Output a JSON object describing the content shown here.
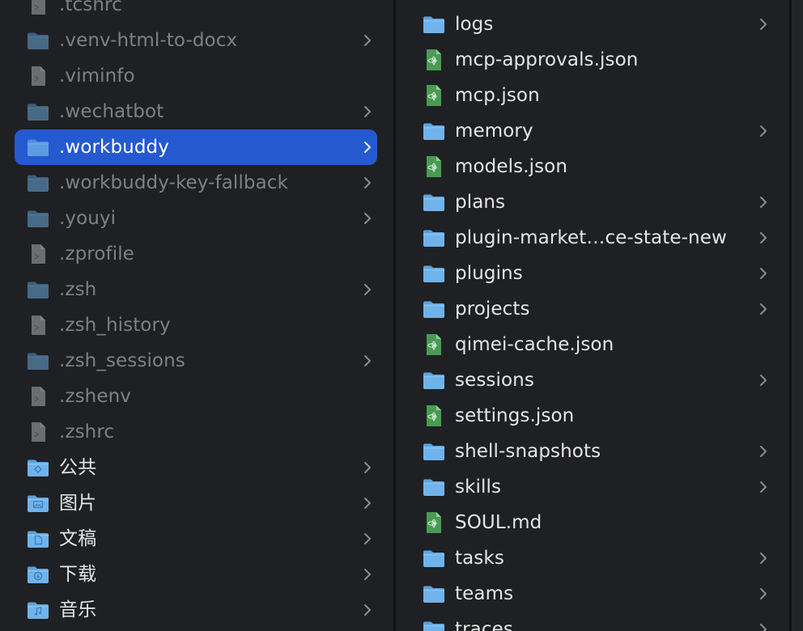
{
  "colors": {
    "background": "#1f2023",
    "selection": "#2559d0",
    "folder_blue": "#6fb3ea",
    "file_green": "#4b9a54",
    "text": "#e6e6e6",
    "text_dim": "#808084"
  },
  "columns": [
    {
      "id": "left",
      "items": [
        {
          "name": ".tcshrc",
          "kind": "file",
          "dim": true,
          "selected": false,
          "has_children": false
        },
        {
          "name": ".venv-html-to-docx",
          "kind": "folder",
          "dim": true,
          "selected": false,
          "has_children": true
        },
        {
          "name": ".viminfo",
          "kind": "file",
          "dim": true,
          "selected": false,
          "has_children": false
        },
        {
          "name": ".wechatbot",
          "kind": "folder",
          "dim": true,
          "selected": false,
          "has_children": true
        },
        {
          "name": ".workbuddy",
          "kind": "folder",
          "dim": false,
          "selected": true,
          "has_children": true
        },
        {
          "name": ".workbuddy-key-fallback",
          "kind": "folder",
          "dim": true,
          "selected": false,
          "has_children": true
        },
        {
          "name": ".youyi",
          "kind": "folder",
          "dim": true,
          "selected": false,
          "has_children": true
        },
        {
          "name": ".zprofile",
          "kind": "file",
          "dim": true,
          "selected": false,
          "has_children": false
        },
        {
          "name": ".zsh",
          "kind": "folder",
          "dim": true,
          "selected": false,
          "has_children": true
        },
        {
          "name": ".zsh_history",
          "kind": "file",
          "dim": true,
          "selected": false,
          "has_children": false
        },
        {
          "name": ".zsh_sessions",
          "kind": "folder",
          "dim": true,
          "selected": false,
          "has_children": true
        },
        {
          "name": ".zshenv",
          "kind": "file",
          "dim": true,
          "selected": false,
          "has_children": false
        },
        {
          "name": ".zshrc",
          "kind": "file",
          "dim": true,
          "selected": false,
          "has_children": false
        },
        {
          "name": "公共",
          "kind": "public-folder",
          "dim": false,
          "selected": false,
          "has_children": true
        },
        {
          "name": "图片",
          "kind": "pictures-folder",
          "dim": false,
          "selected": false,
          "has_children": true
        },
        {
          "name": "文稿",
          "kind": "documents-folder",
          "dim": false,
          "selected": false,
          "has_children": true
        },
        {
          "name": "下载",
          "kind": "downloads-folder",
          "dim": false,
          "selected": false,
          "has_children": true
        },
        {
          "name": "音乐",
          "kind": "music-folder",
          "dim": false,
          "selected": false,
          "has_children": true
        }
      ]
    },
    {
      "id": "right",
      "items": [
        {
          "name": "logs",
          "kind": "folder",
          "dim": false,
          "selected": false,
          "has_children": true
        },
        {
          "name": "mcp-approvals.json",
          "kind": "json",
          "dim": false,
          "selected": false,
          "has_children": false
        },
        {
          "name": "mcp.json",
          "kind": "json",
          "dim": false,
          "selected": false,
          "has_children": false
        },
        {
          "name": "memory",
          "kind": "folder",
          "dim": false,
          "selected": false,
          "has_children": true
        },
        {
          "name": "models.json",
          "kind": "json",
          "dim": false,
          "selected": false,
          "has_children": false
        },
        {
          "name": "plans",
          "kind": "folder",
          "dim": false,
          "selected": false,
          "has_children": true
        },
        {
          "name": "plugin-market…ce-state-new",
          "kind": "folder",
          "dim": false,
          "selected": false,
          "has_children": true
        },
        {
          "name": "plugins",
          "kind": "folder",
          "dim": false,
          "selected": false,
          "has_children": true
        },
        {
          "name": "projects",
          "kind": "folder",
          "dim": false,
          "selected": false,
          "has_children": true
        },
        {
          "name": "qimei-cache.json",
          "kind": "json",
          "dim": false,
          "selected": false,
          "has_children": false
        },
        {
          "name": "sessions",
          "kind": "folder",
          "dim": false,
          "selected": false,
          "has_children": true
        },
        {
          "name": "settings.json",
          "kind": "json",
          "dim": false,
          "selected": false,
          "has_children": false
        },
        {
          "name": "shell-snapshots",
          "kind": "folder",
          "dim": false,
          "selected": false,
          "has_children": true
        },
        {
          "name": "skills",
          "kind": "folder",
          "dim": false,
          "selected": false,
          "has_children": true
        },
        {
          "name": "SOUL.md",
          "kind": "json",
          "dim": false,
          "selected": false,
          "has_children": false
        },
        {
          "name": "tasks",
          "kind": "folder",
          "dim": false,
          "selected": false,
          "has_children": true
        },
        {
          "name": "teams",
          "kind": "folder",
          "dim": false,
          "selected": false,
          "has_children": true
        },
        {
          "name": "traces",
          "kind": "folder",
          "dim": false,
          "selected": false,
          "has_children": true
        }
      ]
    }
  ]
}
